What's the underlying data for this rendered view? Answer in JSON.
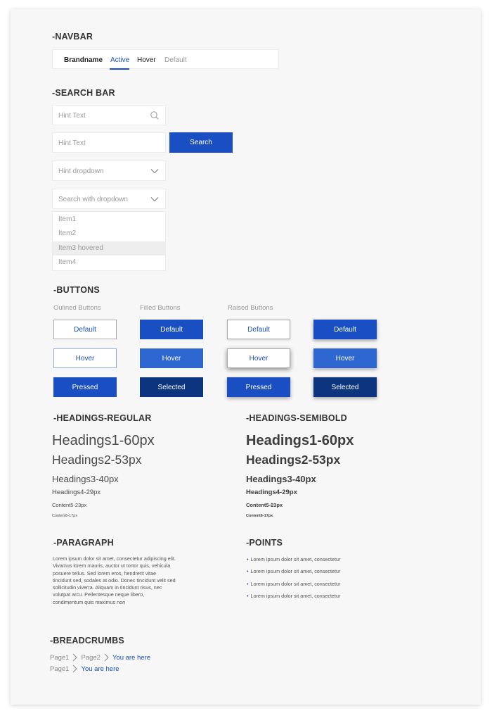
{
  "sections": {
    "navbar": "-NAVBAR",
    "search": "-SEARCH BAR",
    "buttons": "-BUTTONS",
    "headings_regular": "-HEADINGS-REGULAR",
    "headings_semibold": "-HEADINGS-SEMIBOLD",
    "paragraph": "-PARAGRAPH",
    "points": "-POINTS",
    "breadcrumbs": "-BREADCRUMBS"
  },
  "navbar": {
    "brand": "Brandname",
    "active": "Active",
    "hover": "Hover",
    "default": "Default"
  },
  "search": {
    "field1_hint": "Hint Text",
    "field2_hint": "Hint Text",
    "search_button": "Search",
    "dropdown_hint": "Hint dropdown",
    "search_dropdown_hint": "Search with dropdown",
    "items": [
      "Item1",
      "Item2",
      "Item3 hovered",
      "Item4"
    ]
  },
  "buttons": {
    "outlined_label": "Oulined Buttons",
    "filled_label": "Filled Buttons",
    "raised_label": "Raised Buttons",
    "default": "Default",
    "hover": "Hover",
    "pressed": "Pressed",
    "selected": "Selected"
  },
  "headings": {
    "h1": "Headings1-60px",
    "h2": "Headings2-53px",
    "h3": "Headings3-40px",
    "h4": "Headings4-29px",
    "c5": "Content5-23px",
    "c6": "Content6-17px"
  },
  "paragraph": "Lorem ipsum dolor sit amet, consectetur adipiscing elit. Vivamus lorem mauris, auctor ut tortor quis, vehicula posuere tellus. Sed lorem eros, hendrerit vitae tincidunt sed, sodales at odio. Donec tincidunt velit sed sollicitudin viverra. Aliquam in tincidunt risus, nec volutpat arcu. Pellentesque neque libero, condimentum quis maximus non",
  "points": [
    "Lorem ipsum dolor sit amet, consectetur",
    "Lorem ipsum dolor sit amet, consectetur",
    "Lorem ipsum dolor sit amet, consectetur",
    "Lorem ipsum dolor sit amet, consectetur"
  ],
  "breadcrumbs": {
    "row1": [
      "Page1",
      "Page2",
      "You are here"
    ],
    "row2": [
      "Page1",
      "You are here"
    ]
  },
  "colors": {
    "accent": "#1a4fc4",
    "accent_hover": "#2f67d1",
    "accent_dark": "#0d357f",
    "muted_text": "#9a9a9a"
  }
}
